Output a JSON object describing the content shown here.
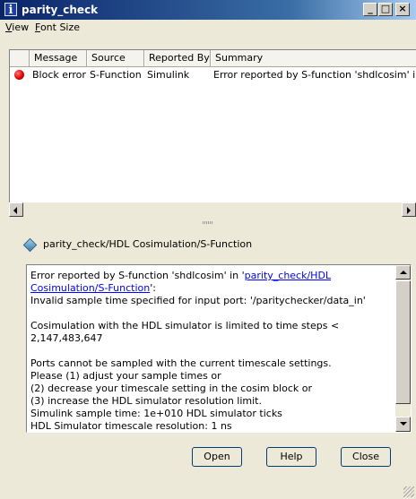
{
  "window": {
    "title": "parity_check",
    "title_icon": "info-icon",
    "controls": {
      "minimize": "_",
      "maximize": "□",
      "close": "×"
    }
  },
  "menubar": {
    "items": [
      "View",
      "Font Size"
    ]
  },
  "table": {
    "columns": [
      "Message",
      "Source",
      "Reported By",
      "Summary"
    ],
    "rows": [
      {
        "icon": "error-icon",
        "message": "Block error",
        "source": "S-Function",
        "reported_by": "Simulink",
        "summary": "Error reported by S-function 'shdlcosim' in 'pa"
      }
    ]
  },
  "block_path": {
    "icon": "block-diamond-icon",
    "text": "parity_check/HDL Cosimulation/S-Function"
  },
  "message": {
    "lines": [
      {
        "prefix": "Error reported by S-function 'shdlcosim' in '",
        "link": "parity_check/HDL Cosimulation/S-Function",
        "suffix": "':"
      },
      "Invalid sample time specified for input port: '/paritychecker/data_in'",
      "",
      "Cosimulation with the HDL simulator is limited to time steps < 2,147,483,647",
      "",
      "Ports cannot be sampled with the current timescale settings.",
      "Please (1) adjust your sample times or",
      "(2) decrease your timescale setting in the cosim block or",
      "(3) increase the HDL simulator resolution limit.",
      "Simulink sample time: 1e+010 HDL simulator ticks",
      "HDL Simulator timescale resolution: 1 ns"
    ]
  },
  "buttons": {
    "open": "Open",
    "help": "Help",
    "close": "Close"
  },
  "colors": {
    "titlebar_start": "#0a246a",
    "titlebar_end": "#a6caf0",
    "link": "#0000ff",
    "error": "#e00000",
    "dialog_bg": "#ece9d8"
  }
}
